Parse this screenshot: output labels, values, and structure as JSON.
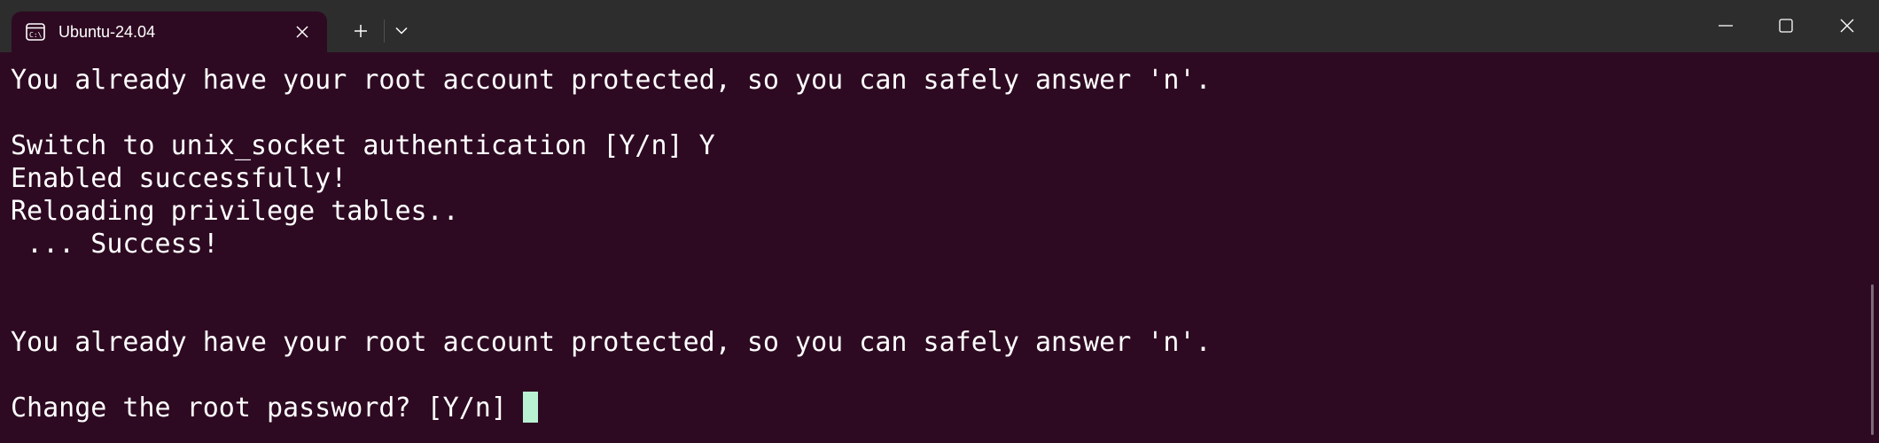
{
  "tab": {
    "title": "Ubuntu-24.04",
    "icon": "terminal-icon",
    "close_icon": "close-icon"
  },
  "tab_bar": {
    "new_tab_icon": "plus-icon",
    "dropdown_icon": "chevron-down-icon"
  },
  "window_controls": {
    "minimize_icon": "minimize-icon",
    "maximize_icon": "maximize-icon",
    "close_icon": "close-icon"
  },
  "terminal": {
    "lines": [
      "You already have your root account protected, so you can safely answer 'n'.",
      "",
      "Switch to unix_socket authentication [Y/n] Y",
      "Enabled successfully!",
      "Reloading privilege tables..",
      " ... Success!",
      "",
      "",
      "You already have your root account protected, so you can safely answer 'n'.",
      "",
      "Change the root password? [Y/n] "
    ]
  },
  "colors": {
    "background": "#2e0a22",
    "titlebar": "#2d2d2d",
    "foreground": "#ffffff",
    "cursor": "#b8f2d2"
  }
}
